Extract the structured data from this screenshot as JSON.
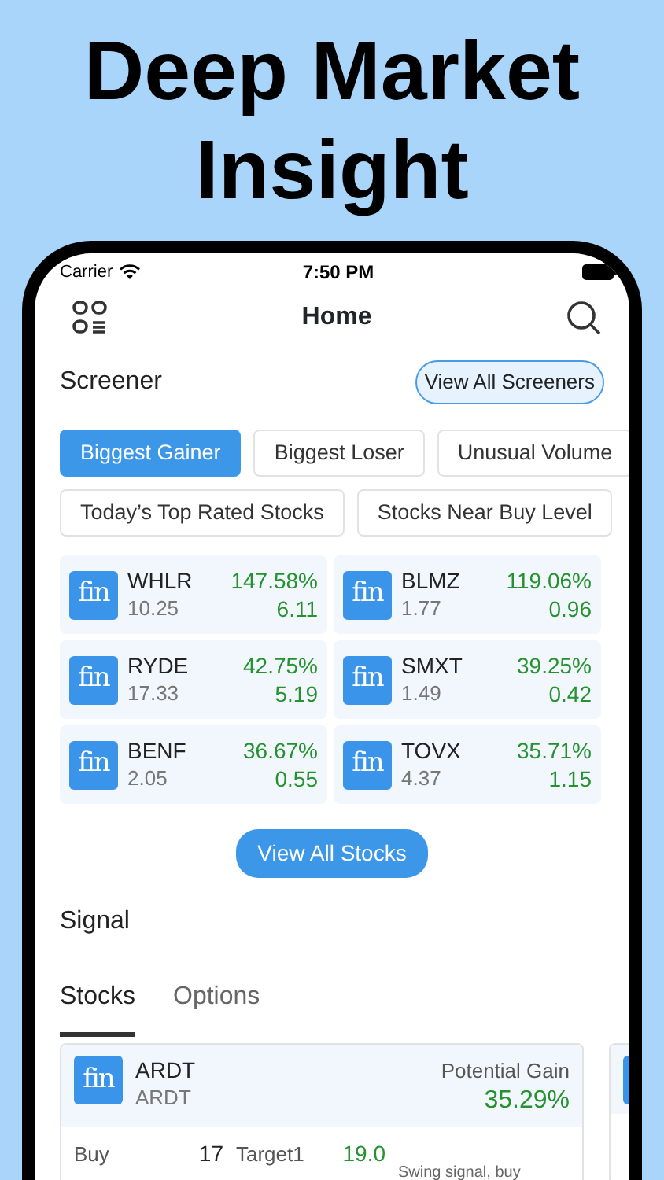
{
  "headline": "Deep Market Insight",
  "status_bar": {
    "carrier": "Carrier",
    "time": "7:50 PM"
  },
  "nav": {
    "title": "Home"
  },
  "screener": {
    "title": "Screener",
    "action": "View All Screeners",
    "chip_rows": [
      [
        {
          "label": "Biggest Gainer",
          "selected": true
        },
        {
          "label": "Biggest Loser",
          "selected": false
        },
        {
          "label": "Unusual Volume",
          "selected": false
        }
      ],
      [
        {
          "label": "Today’s Top Rated Stocks",
          "selected": false
        },
        {
          "label": "Stocks Near Buy Level",
          "selected": false
        }
      ]
    ],
    "stocks": [
      {
        "logo": "fin",
        "symbol": "WHLR",
        "price": "10.25",
        "change_pct": "147.58%",
        "change": "6.11"
      },
      {
        "logo": "fin",
        "symbol": "BLMZ",
        "price": "1.77",
        "change_pct": "119.06%",
        "change": "0.96"
      },
      {
        "logo": "fin",
        "symbol": "RYDE",
        "price": "17.33",
        "change_pct": "42.75%",
        "change": "5.19"
      },
      {
        "logo": "fin",
        "symbol": "SMXT",
        "price": "1.49",
        "change_pct": "39.25%",
        "change": "0.42"
      },
      {
        "logo": "fin",
        "symbol": "BENF",
        "price": "2.05",
        "change_pct": "36.67%",
        "change": "0.55"
      },
      {
        "logo": "fin",
        "symbol": "TOVX",
        "price": "4.37",
        "change_pct": "35.71%",
        "change": "1.15"
      }
    ],
    "view_all": "View All Stocks"
  },
  "signal": {
    "title": "Signal",
    "tabs": [
      {
        "label": "Stocks",
        "selected": true
      },
      {
        "label": "Options",
        "selected": false
      }
    ],
    "cards": [
      {
        "logo": "fin",
        "symbol": "ARDT",
        "name": "ARDT",
        "gain_label": "Potential Gain",
        "gain": "35.29%",
        "buy_label": "Buy",
        "buy": "17",
        "target_label": "Target1",
        "target": "19.0",
        "note": "Swing signal, buy"
      }
    ]
  }
}
